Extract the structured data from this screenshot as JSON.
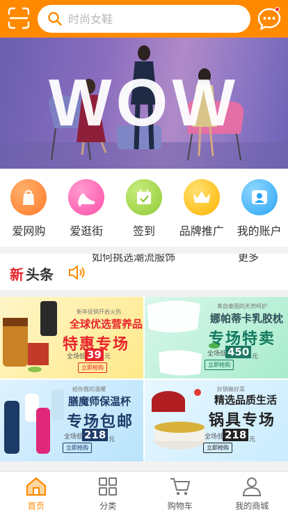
{
  "header": {
    "search_placeholder": "时尚女鞋"
  },
  "banner": {
    "headline": "WOW",
    "slide_count": 4,
    "active_slide": 2
  },
  "quick_nav": [
    {
      "label": "爱网购",
      "icon": "shopping-bag-icon",
      "color": "#ff8a3d"
    },
    {
      "label": "爱逛街",
      "icon": "high-heel-icon",
      "color": "#ff5db1"
    },
    {
      "label": "签到",
      "icon": "calendar-check-icon",
      "color": "#9ed14b"
    },
    {
      "label": "品牌推广",
      "icon": "crown-icon",
      "color": "#ffc21a"
    },
    {
      "label": "我的账户",
      "icon": "user-icon",
      "color": "#3db4ff"
    }
  ],
  "headline": {
    "logo_accent": "新",
    "logo_rest": "头条",
    "news_text": "如何挑选潮流服饰",
    "more_text": "更多"
  },
  "promos": [
    {
      "tag": "新年促销开启火热",
      "title": "全球优选营养品",
      "big": "特惠专场",
      "low": "全场低至",
      "price": "39",
      "unit": "元",
      "cta": "立即抢购"
    },
    {
      "tag": "来自泰国的天然呵护",
      "title": "娜帕蒂卡乳胶枕",
      "big": "专场特卖",
      "low": "全场低至",
      "price": "450",
      "unit": "元",
      "cta": "立即抢购"
    },
    {
      "tag": "给你我的温暖",
      "title": "膳魔师保温杯",
      "big": "专场包邮",
      "low": "全场低至",
      "price": "218",
      "unit": "元",
      "cta": "立即抢购"
    },
    {
      "tag": "好锅做好菜",
      "title": "精选品质生活",
      "big": "锅具专场",
      "low": "全场低至",
      "price": "218",
      "unit": "元",
      "cta": "立即抢购"
    }
  ],
  "tabbar": [
    {
      "label": "首页",
      "icon": "home-icon",
      "active": true
    },
    {
      "label": "分类",
      "icon": "grid-icon",
      "active": false
    },
    {
      "label": "购物车",
      "icon": "cart-icon",
      "active": false
    },
    {
      "label": "我的商城",
      "icon": "profile-icon",
      "active": false
    }
  ],
  "colors": {
    "brand": "#ff8a00",
    "alert": "#e8242c"
  }
}
